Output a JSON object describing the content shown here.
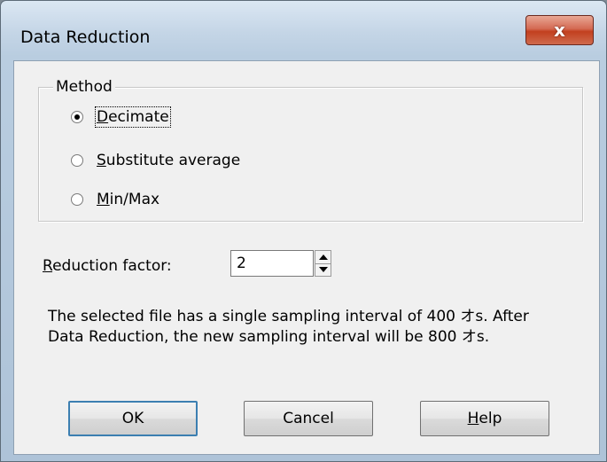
{
  "window": {
    "title": "Data Reduction",
    "close_glyph": "x"
  },
  "method": {
    "group_label": "Method",
    "options": [
      {
        "prefix": "",
        "mnemonic": "D",
        "rest": "ecimate",
        "checked": true
      },
      {
        "prefix": "",
        "mnemonic": "S",
        "rest": "ubstitute average",
        "checked": false
      },
      {
        "prefix": "",
        "mnemonic": "M",
        "rest": "in/Max",
        "checked": false
      }
    ]
  },
  "reduction": {
    "label_mnemonic": "R",
    "label_rest": "eduction factor:",
    "value": "2"
  },
  "info": {
    "line1": "The selected file has a single sampling interval of 400 オs. After",
    "line2": "Data Reduction, the new sampling interval will be 800 オs."
  },
  "buttons": {
    "ok": "OK",
    "cancel": "Cancel",
    "help_mnemonic": "H",
    "help_rest": "elp"
  }
}
